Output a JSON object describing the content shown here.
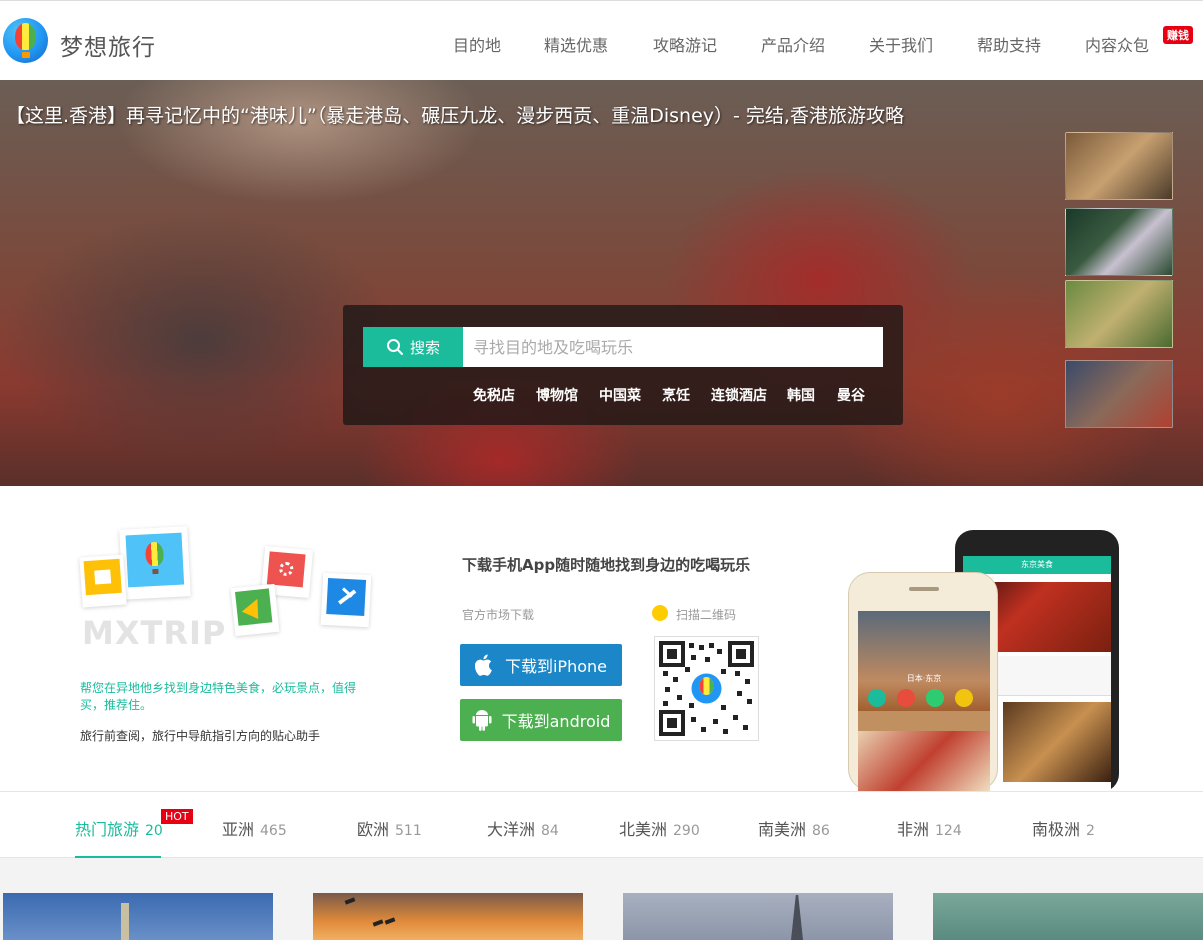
{
  "header": {
    "brand": "梦想旅行",
    "nav": [
      "目的地",
      "精选优惠",
      "攻略游记",
      "产品介绍",
      "关于我们",
      "帮助支持",
      "内容众包"
    ],
    "earn_badge": "赚钱"
  },
  "hero": {
    "title": "【这里.香港】再寻记忆中的“港味儿”（暴走港岛、碾压九龙、漫步西贡、重温Disney）- 完结,香港旅游攻略",
    "search": {
      "button_label": "搜索",
      "placeholder": "寻找目的地及吃喝玩乐"
    },
    "hot_keywords": [
      "免税店",
      "博物馆",
      "中国菜",
      "烹饪",
      "连锁酒店",
      "韩国",
      "曼谷"
    ]
  },
  "promo": {
    "watermark": "MXTRIP",
    "tagline": "帮您在异地他乡找到身边特色美食，必玩景点，值得买，推荐住。",
    "subtagline": "旅行前查阅，旅行中导航指引方向的贴心助手",
    "heading": "下载手机App随时随地找到身边的吃喝玩乐",
    "market_label": "官方市场下载",
    "qr_label": "扫描二维码",
    "ios_button": "下载到iPhone",
    "android_button": "下载到android",
    "phone_back_title": "东京美食",
    "phone_front_city": "日本·东京"
  },
  "tabs": {
    "items": [
      {
        "label": "热门旅游",
        "count": "20"
      },
      {
        "label": "亚洲",
        "count": "465"
      },
      {
        "label": "欧洲",
        "count": "511"
      },
      {
        "label": "大洋洲",
        "count": "84"
      },
      {
        "label": "北美洲",
        "count": "290"
      },
      {
        "label": "南美洲",
        "count": "86"
      },
      {
        "label": "非洲",
        "count": "124"
      },
      {
        "label": "南极洲",
        "count": "2"
      }
    ],
    "hot_badge": "HOT",
    "active_index": 0
  },
  "colors": {
    "accent": "#1abc9c",
    "badge_red": "#e60012",
    "ios_blue": "#1b87c9",
    "android_green": "#4caf50"
  }
}
